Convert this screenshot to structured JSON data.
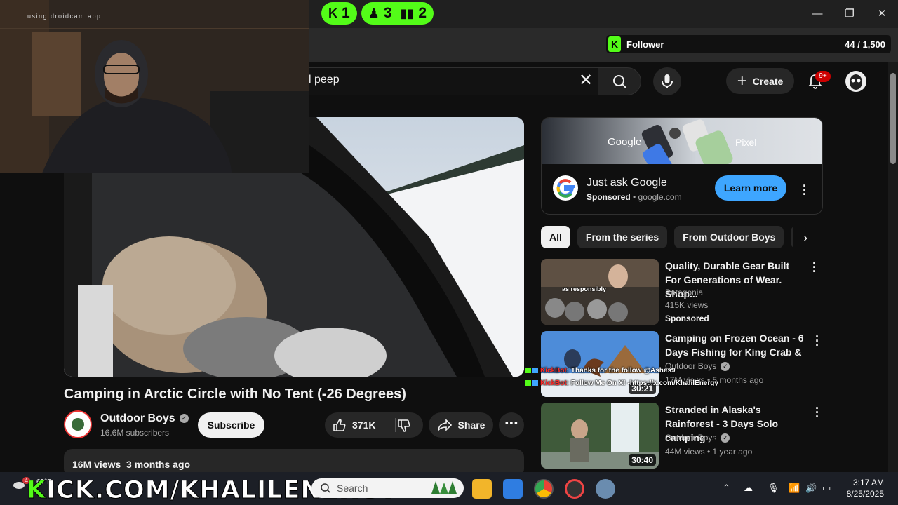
{
  "overlay": {
    "webcam_watermark": "using droidcam.app",
    "kick_stats": [
      {
        "icon": "kick-k-icon",
        "value": "1"
      },
      {
        "icon": "person-icon",
        "value": "3"
      },
      {
        "icon": "bar-chart-icon",
        "value": "2"
      }
    ],
    "follower_goal": {
      "label": "Follower",
      "count": "44 / 1,500",
      "progress": 0.029
    },
    "chat": [
      {
        "user": "KickBot",
        "message": ": Thanks for the follow @Ashes9"
      },
      {
        "user": "KickBot",
        "message": ": Follow Me On X! -https://x.com/KhalilEnergy"
      }
    ],
    "kick_url": "KICK.COM/KHALILENERGY",
    "accent": "#53fc18"
  },
  "header": {
    "search_value": "l peep",
    "create_label": "Create",
    "notifications_badge": "9+"
  },
  "video": {
    "title": "Camping in Arctic Circle with No Tent (-26 Degrees)",
    "channel": "Outdoor Boys",
    "subscribers": "16.6M subscribers",
    "subscribe_label": "Subscribe",
    "likes": "371K",
    "share_label": "Share",
    "views": "16M views",
    "age": "3 months ago"
  },
  "ad": {
    "banner_brand": "Google",
    "banner_product": "Pixel",
    "title": "Just ask Google",
    "sponsored": "Sponsored",
    "domain": "google.com",
    "cta": "Learn more"
  },
  "chips": [
    "All",
    "From the series",
    "From Outdoor Boys",
    "S"
  ],
  "recommendations": [
    {
      "title": "Quality, Durable Gear Built For Generations of Wear. Shop...",
      "channel": "Patagonia",
      "meta": "415K views",
      "sponsored": "Sponsored",
      "thumb_caption": "as responsibly"
    },
    {
      "title": "Camping on Frozen Ocean - 6 Days Fishing for King Crab & ...",
      "channel": "Outdoor Boys",
      "meta": "17M views • 5 months ago",
      "duration": "30:21"
    },
    {
      "title": "Stranded in Alaska's Rainforest - 3 Days Solo camping",
      "channel": "Outdoor Boys",
      "meta": "44M views • 1 year ago",
      "duration": "30:40"
    }
  ],
  "taskbar": {
    "search_placeholder": "Search",
    "weather_temp": "69°F",
    "weather_badge": "4",
    "time": "3:17 AM",
    "date": "8/25/2025"
  }
}
